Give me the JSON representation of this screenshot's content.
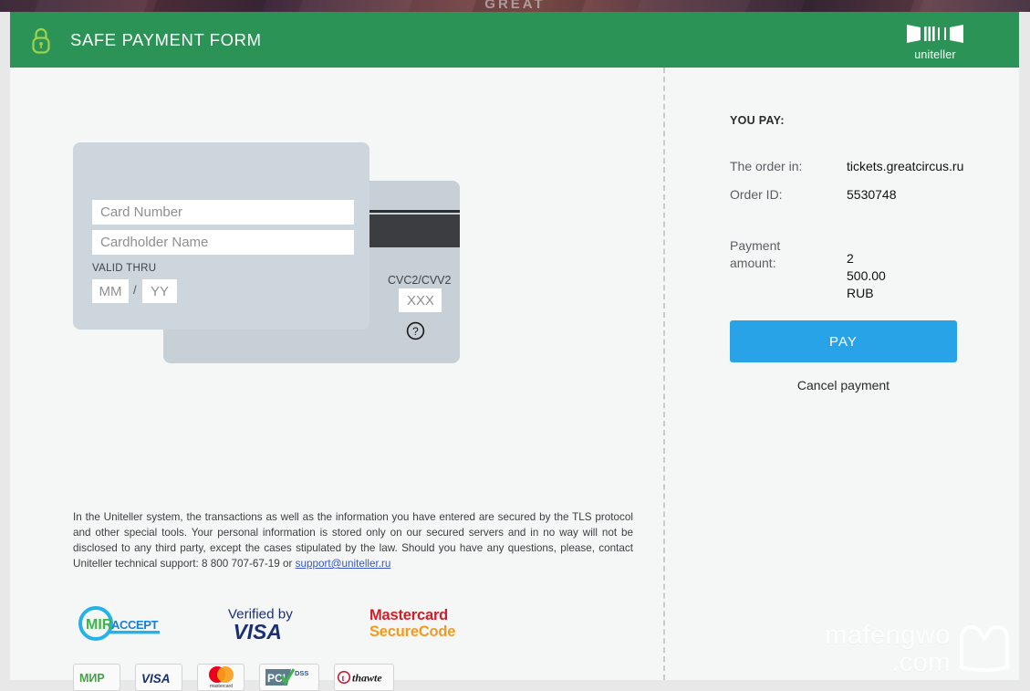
{
  "background_strip": {
    "word": "GREAT"
  },
  "header": {
    "title": "SAFE PAYMENT FORM",
    "lock_icon": "padlock-icon",
    "brand_name": "uniteller",
    "bg_color": "#2c9356",
    "lock_color": "#9fd14f"
  },
  "card_form": {
    "card_number": {
      "placeholder": "Card Number",
      "value": ""
    },
    "cardholder_name": {
      "placeholder": "Cardholder Name",
      "value": ""
    },
    "valid_thru_label": "VALID THRU",
    "month": {
      "placeholder": "MM",
      "value": ""
    },
    "separator": "/",
    "year": {
      "placeholder": "YY",
      "value": ""
    },
    "cvv_label": "CVC2/CVV2",
    "cvv": {
      "placeholder": "XXX",
      "value": ""
    },
    "cvv_help_icon": "question-mark-circle-icon"
  },
  "legal": {
    "text_before_link": "In the Uniteller system, the transactions as well as the information you have entered are secured by the TLS protocol and other special tools. Your personal information is stored only on our secured servers and in no way will not be disclosed to any third party, except the cases stipulated by the law. Should you have any questions, please, contact Uniteller technical support: 8 800 707-67-19 or ",
    "support_phone": "8 800 707-67-19",
    "support_email": "support@uniteller.ru",
    "link_color": "#3a57c4"
  },
  "certification_logos": [
    {
      "name": "mir-accept-logo",
      "text_main": "MIR",
      "text_sub": "ACCEPT"
    },
    {
      "name": "verified-by-visa-logo",
      "line1": "Verified by",
      "line2": "VISA"
    },
    {
      "name": "mastercard-securecode-logo",
      "line1": "Mastercard",
      "line2": "SecureCode"
    }
  ],
  "payment_badges": [
    {
      "name": "mir-badge",
      "label": "МИР"
    },
    {
      "name": "visa-badge",
      "label": "VISA"
    },
    {
      "name": "mastercard-badge",
      "label": "mastercard"
    },
    {
      "name": "pci-dss-badge",
      "label": "PCI DSS"
    },
    {
      "name": "thawte-badge",
      "label": "thawte"
    }
  ],
  "summary": {
    "heading": "YOU PAY:",
    "order_in_label": "The order in:",
    "order_in_value": "tickets.greatcircus.ru",
    "order_id_label": "Order ID:",
    "order_id_value": "5530748",
    "amount_label": "Payment amount:",
    "amount_value": "2 500.00 RUB",
    "pay_button": "PAY",
    "cancel_link": "Cancel payment",
    "pay_button_color": "#29a3e8"
  },
  "watermark": {
    "line1": "mafengwo",
    "line2": ".com",
    "mark": "mafengwo-m-logo"
  }
}
